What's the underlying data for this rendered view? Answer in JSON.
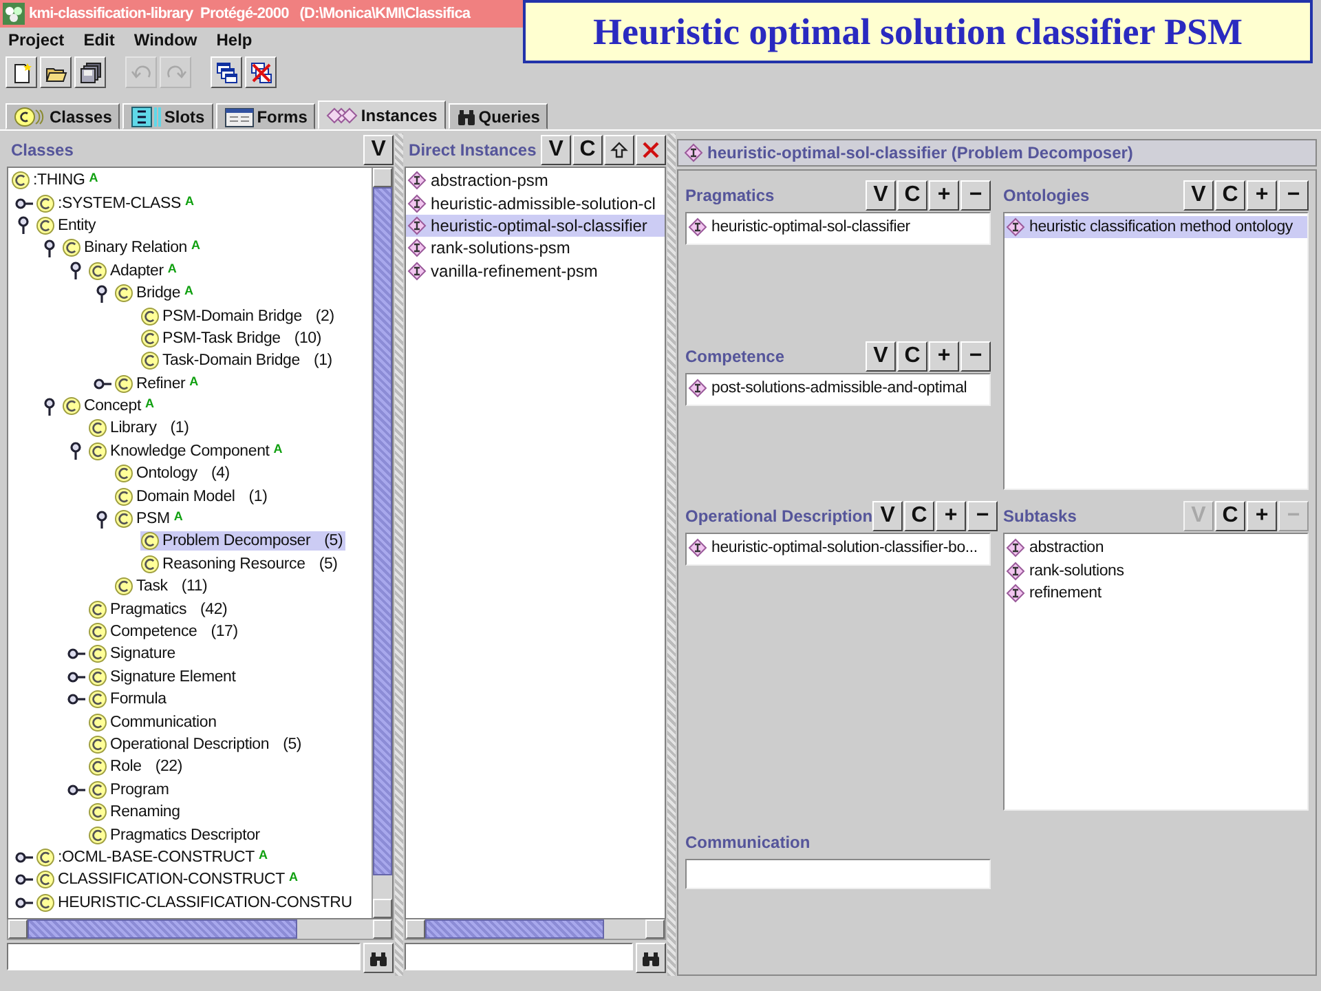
{
  "window": {
    "title": "kmi-classification-library  Protégé-2000   (D:\\Monica\\KMI\\Classifica"
  },
  "slide_title": "Heuristic optimal solution classifier PSM",
  "menu": [
    "Project",
    "Edit",
    "Window",
    "Help"
  ],
  "toolbar": [
    [
      {
        "kind": "new",
        "disabled": false
      },
      {
        "kind": "open",
        "disabled": false
      },
      {
        "kind": "save",
        "disabled": false
      }
    ],
    [
      {
        "kind": "undo",
        "disabled": true
      },
      {
        "kind": "redo",
        "disabled": true
      }
    ],
    [
      {
        "kind": "cascade",
        "disabled": false
      },
      {
        "kind": "close-all",
        "disabled": false
      }
    ]
  ],
  "tabs": [
    {
      "label": "Classes",
      "kind": "classes",
      "selected": false
    },
    {
      "label": "Slots",
      "kind": "slots",
      "selected": false
    },
    {
      "label": "Forms",
      "kind": "forms",
      "selected": false
    },
    {
      "label": "Instances",
      "kind": "instances",
      "selected": true
    },
    {
      "label": "Queries",
      "kind": "queries",
      "selected": false
    }
  ],
  "classes_pane": {
    "title": "Classes",
    "buttons": [
      {
        "label": "V",
        "disabled": false
      }
    ],
    "tree": [
      {
        "label": ":THING",
        "badge": "A",
        "selected": false,
        "children": [
          {
            "label": ":SYSTEM-CLASS",
            "badge": "A",
            "selected": false,
            "expanded": false
          },
          {
            "label": "Entity",
            "selected": false,
            "expanded": true,
            "children": [
              {
                "label": "Binary Relation",
                "badge": "A",
                "selected": false,
                "expanded": true,
                "children": [
                  {
                    "label": "Adapter",
                    "badge": "A",
                    "selected": false,
                    "expanded": true,
                    "children": [
                      {
                        "label": "Bridge",
                        "badge": "A",
                        "selected": false,
                        "expanded": true,
                        "children": [
                          {
                            "label": "PSM-Domain Bridge",
                            "count": "(2)",
                            "selected": false
                          },
                          {
                            "label": "PSM-Task Bridge",
                            "count": "(10)",
                            "selected": false
                          },
                          {
                            "label": "Task-Domain Bridge",
                            "count": "(1)",
                            "selected": false
                          }
                        ]
                      },
                      {
                        "label": "Refiner",
                        "badge": "A",
                        "selected": false,
                        "expanded": false
                      }
                    ]
                  }
                ]
              },
              {
                "label": "Concept",
                "badge": "A",
                "selected": false,
                "expanded": true,
                "children": [
                  {
                    "label": "Library",
                    "count": "(1)",
                    "selected": false
                  },
                  {
                    "label": "Knowledge Component",
                    "badge": "A",
                    "selected": false,
                    "expanded": true,
                    "children": [
                      {
                        "label": "Ontology",
                        "count": "(4)",
                        "selected": false
                      },
                      {
                        "label": "Domain Model",
                        "count": "(1)",
                        "selected": false
                      },
                      {
                        "label": "PSM",
                        "badge": "A",
                        "selected": false,
                        "expanded": true,
                        "children": [
                          {
                            "label": "Problem Decomposer",
                            "count": "(5)",
                            "selected": true
                          },
                          {
                            "label": "Reasoning Resource",
                            "count": "(5)",
                            "selected": false
                          }
                        ]
                      },
                      {
                        "label": "Task",
                        "count": "(11)",
                        "selected": false
                      }
                    ]
                  },
                  {
                    "label": "Pragmatics",
                    "count": "(42)",
                    "selected": false
                  },
                  {
                    "label": "Competence",
                    "count": "(17)",
                    "selected": false
                  },
                  {
                    "label": "Signature",
                    "selected": false,
                    "expanded": false
                  },
                  {
                    "label": "Signature Element",
                    "selected": false,
                    "expanded": false
                  },
                  {
                    "label": "Formula",
                    "selected": false,
                    "expanded": false
                  },
                  {
                    "label": "Communication",
                    "selected": false
                  },
                  {
                    "label": "Operational Description",
                    "count": "(5)",
                    "selected": false
                  },
                  {
                    "label": "Role",
                    "count": "(22)",
                    "selected": false
                  },
                  {
                    "label": "Program",
                    "selected": false,
                    "expanded": false
                  },
                  {
                    "label": "Renaming",
                    "selected": false
                  },
                  {
                    "label": "Pragmatics Descriptor",
                    "selected": false
                  }
                ]
              }
            ]
          },
          {
            "label": ":OCML-BASE-CONSTRUCT",
            "badge": "A",
            "selected": false,
            "expanded": false
          },
          {
            "label": "CLASSIFICATION-CONSTRUCT",
            "badge": "A",
            "selected": false,
            "expanded": false
          },
          {
            "label": "HEURISTIC-CLASSIFICATION-CONSTRU",
            "selected": false,
            "expanded": false
          }
        ]
      }
    ]
  },
  "instances_pane": {
    "title": "Direct Instances",
    "buttons": [
      {
        "kind": "text",
        "label": "V",
        "disabled": false
      },
      {
        "kind": "text",
        "label": "C",
        "disabled": false
      },
      {
        "kind": "move-up",
        "disabled": false
      },
      {
        "kind": "delete",
        "disabled": false
      }
    ],
    "items": [
      {
        "label": "abstraction-psm",
        "selected": false
      },
      {
        "label": "heuristic-admissible-solution-cl",
        "selected": false
      },
      {
        "label": "heuristic-optimal-sol-classifier",
        "selected": true
      },
      {
        "label": "rank-solutions-psm",
        "selected": false
      },
      {
        "label": "vanilla-refinement-psm",
        "selected": false
      }
    ]
  },
  "form": {
    "title": "heuristic-optimal-sol-classifier (Problem Decomposer)",
    "columns": [
      [
        {
          "label": "Pragmatics",
          "kind": "list",
          "buttons": [
            {
              "label": "V",
              "disabled": false
            },
            {
              "label": "C",
              "disabled": false
            },
            {
              "label": "+",
              "disabled": false
            },
            {
              "label": "−",
              "disabled": false
            }
          ],
          "items": [
            {
              "label": "heuristic-optimal-sol-classifier",
              "selected": false
            }
          ]
        },
        {
          "label": "Competence",
          "kind": "list",
          "buttons": [
            {
              "label": "V",
              "disabled": false
            },
            {
              "label": "C",
              "disabled": false
            },
            {
              "label": "+",
              "disabled": false
            },
            {
              "label": "−",
              "disabled": false
            }
          ],
          "items": [
            {
              "label": "post-solutions-admissible-and-optimal",
              "selected": false
            }
          ]
        },
        {
          "label": "Operational Description",
          "kind": "list",
          "buttons": [
            {
              "label": "V",
              "disabled": false
            },
            {
              "label": "C",
              "disabled": false
            },
            {
              "label": "+",
              "disabled": false
            },
            {
              "label": "−",
              "disabled": false
            }
          ],
          "items": [
            {
              "label": "heuristic-optimal-solution-classifier-bo...",
              "selected": false
            }
          ]
        },
        {
          "label": "Communication",
          "kind": "text"
        }
      ],
      [
        {
          "label": "Ontologies",
          "kind": "list",
          "buttons": [
            {
              "label": "V",
              "disabled": false
            },
            {
              "label": "C",
              "disabled": false
            },
            {
              "label": "+",
              "disabled": false
            },
            {
              "label": "−",
              "disabled": false
            }
          ],
          "items": [
            {
              "label": "heuristic classification method ontology",
              "selected": true
            }
          ]
        },
        {
          "label": "Subtasks",
          "kind": "list",
          "buttons": [
            {
              "label": "V",
              "disabled": true
            },
            {
              "label": "C",
              "disabled": false
            },
            {
              "label": "+",
              "disabled": false
            },
            {
              "label": "−",
              "disabled": true
            }
          ],
          "items": [
            {
              "label": "abstraction",
              "selected": false
            },
            {
              "label": "rank-solutions",
              "selected": false
            },
            {
              "label": "refinement",
              "selected": false
            }
          ]
        }
      ]
    ]
  }
}
